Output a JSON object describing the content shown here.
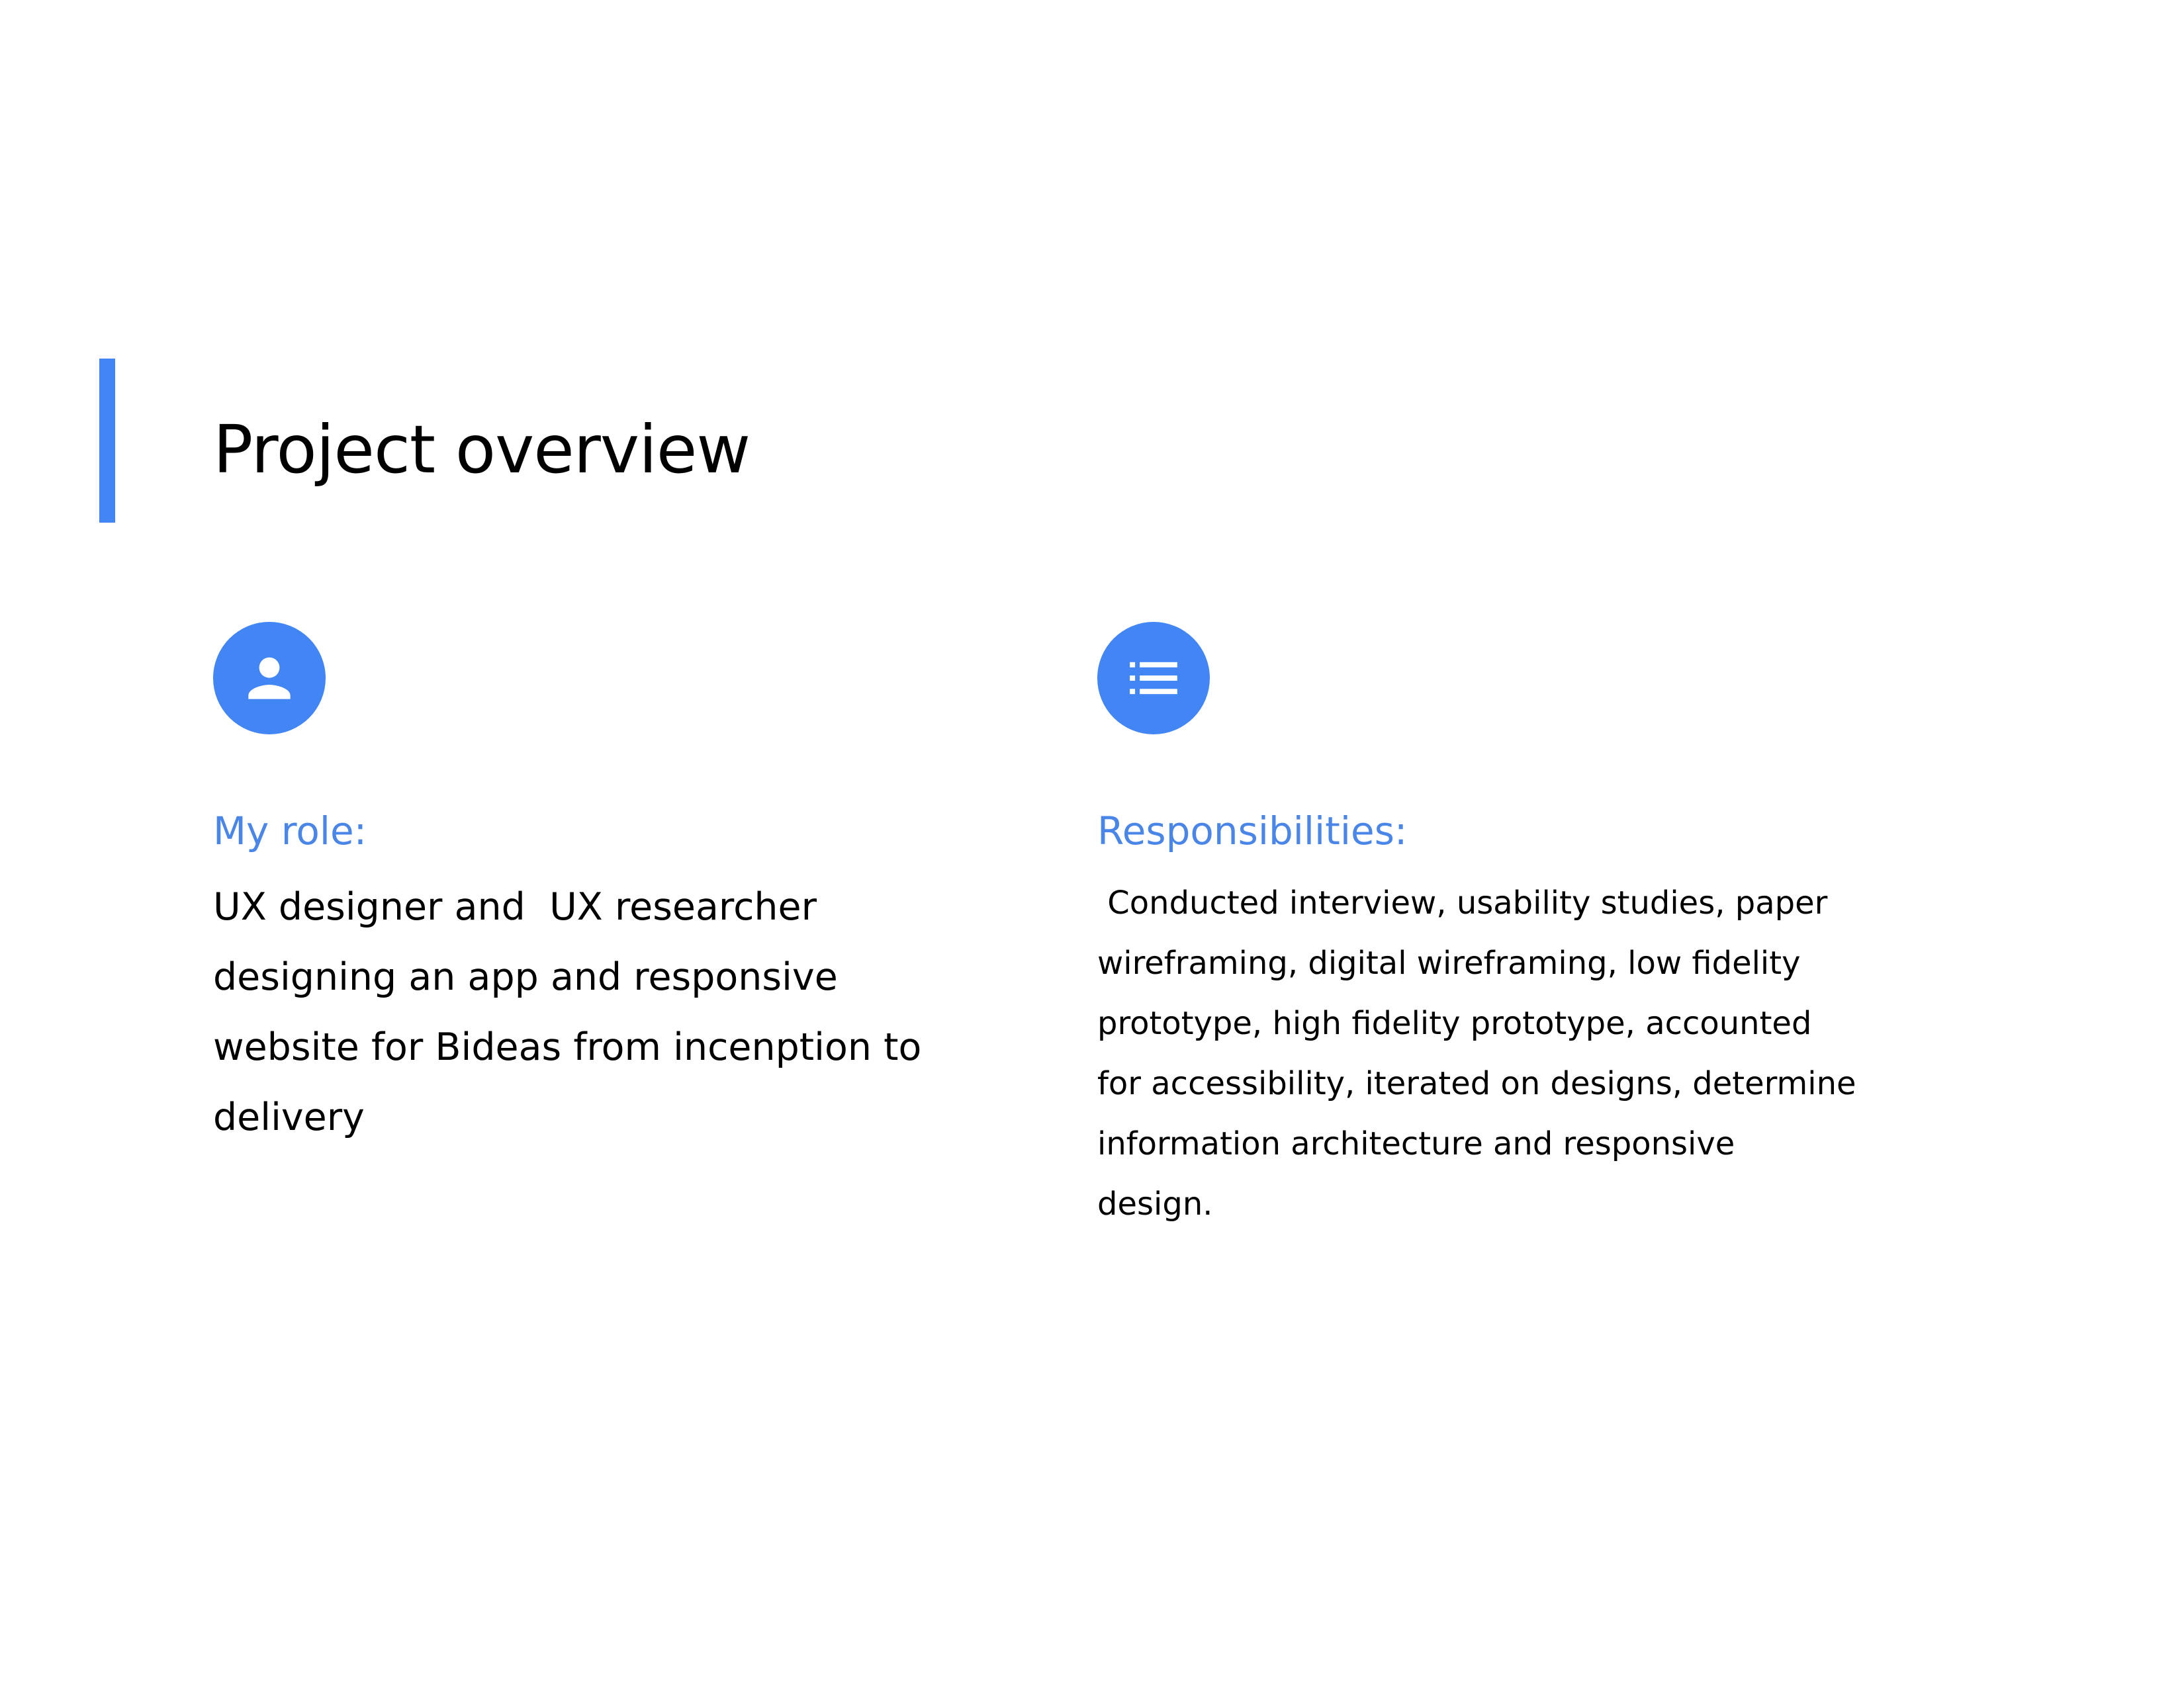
{
  "page": {
    "title": "Project overview",
    "accent_color": "#4285f4",
    "heading_color": "#4a86e8"
  },
  "role": {
    "icon": "person-icon",
    "heading": "My role:",
    "text": "UX designer and  UX researcher designing an app and responsive website for Bideas from incenption to delivery"
  },
  "responsibilities": {
    "icon": "list-icon",
    "heading": "Responsibilities:",
    "text": " Conducted interview, usability studies, paper wireframing, digital wireframing, low fidelity prototype, high fidelity prototype, accounted for accessibility, iterated on designs, determine information architecture and responsive design."
  }
}
